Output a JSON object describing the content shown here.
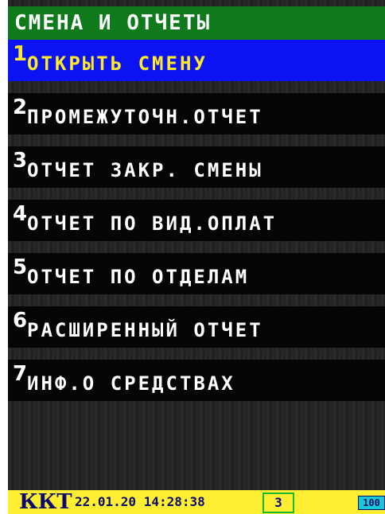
{
  "header": {
    "title": "СМЕНА И ОТЧЕТЫ"
  },
  "menu": {
    "items": [
      {
        "num": "1",
        "label": "ОТКРЫТЬ СМЕНУ"
      },
      {
        "num": "2",
        "label": "ПРОМЕЖУТОЧН.ОТЧЕТ"
      },
      {
        "num": "3",
        "label": "ОТЧЕТ ЗАКР. СМЕНЫ"
      },
      {
        "num": "4",
        "label": "ОТЧЕТ ПО ВИД.ОПЛАТ"
      },
      {
        "num": "5",
        "label": "ОТЧЕТ ПО ОТДЕЛАМ"
      },
      {
        "num": "6",
        "label": "РАСШИРЕННЫЙ ОТЧЕТ"
      },
      {
        "num": "7",
        "label": "ИНФ.О СРЕДСТВАХ"
      }
    ],
    "selected_index": 0
  },
  "status": {
    "device": "ККТ",
    "datetime": "22.01.20 14:28:38",
    "counter": "3",
    "battery": "100"
  },
  "colors": {
    "header_bg": "#0e7a1c",
    "selected_bg": "#0b13f2",
    "selected_text": "#ffea2a",
    "status_bg": "#ffef33"
  }
}
